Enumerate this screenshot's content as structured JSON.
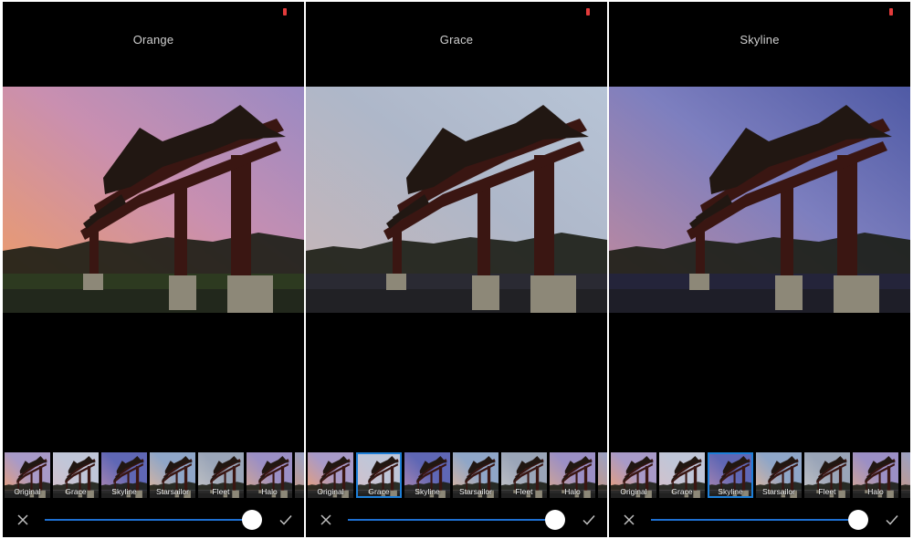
{
  "panels": [
    {
      "filter_title": "Orange",
      "selected_filter": "Original",
      "slider_value": 1.0,
      "sky_colors": [
        "#f09d62",
        "#c98fb0",
        "#9a8ac3"
      ],
      "ground_color": "#2d3a20"
    },
    {
      "filter_title": "Grace",
      "selected_filter": "Grace",
      "slider_value": 1.0,
      "sky_colors": [
        "#c9b6b6",
        "#aeb7c9",
        "#b7c4d6"
      ],
      "ground_color": "#2a2a33"
    },
    {
      "filter_title": "Skyline",
      "selected_filter": "Skyline",
      "slider_value": 1.0,
      "sky_colors": [
        "#c58a9b",
        "#7d7fbf",
        "#4f5aa5"
      ],
      "ground_color": "#24243a"
    }
  ],
  "filters": [
    "Original",
    "Grace",
    "Skyline",
    "Starsailor",
    "Fleet",
    "Halo"
  ],
  "thumb_colors": {
    "Original": [
      "#f0a070",
      "#a89ac8"
    ],
    "Grace": [
      "#d6c0c8",
      "#c0c6d8"
    ],
    "Skyline": [
      "#b58ab0",
      "#5f67b5"
    ],
    "Starsailor": [
      "#e3b79a",
      "#8fa6c8"
    ],
    "Fleet": [
      "#c6c6c6",
      "#9aa5b8"
    ],
    "Halo": [
      "#d9a98f",
      "#9b8fc5"
    ]
  },
  "icons": {
    "cancel": "close-icon",
    "confirm": "checkmark-icon",
    "status": "battery-indicator-icon"
  },
  "colors": {
    "accent": "#1e6fd0",
    "selection_outline": "#1e7fd8",
    "background": "#000000",
    "title_text": "#cfcfcf"
  }
}
